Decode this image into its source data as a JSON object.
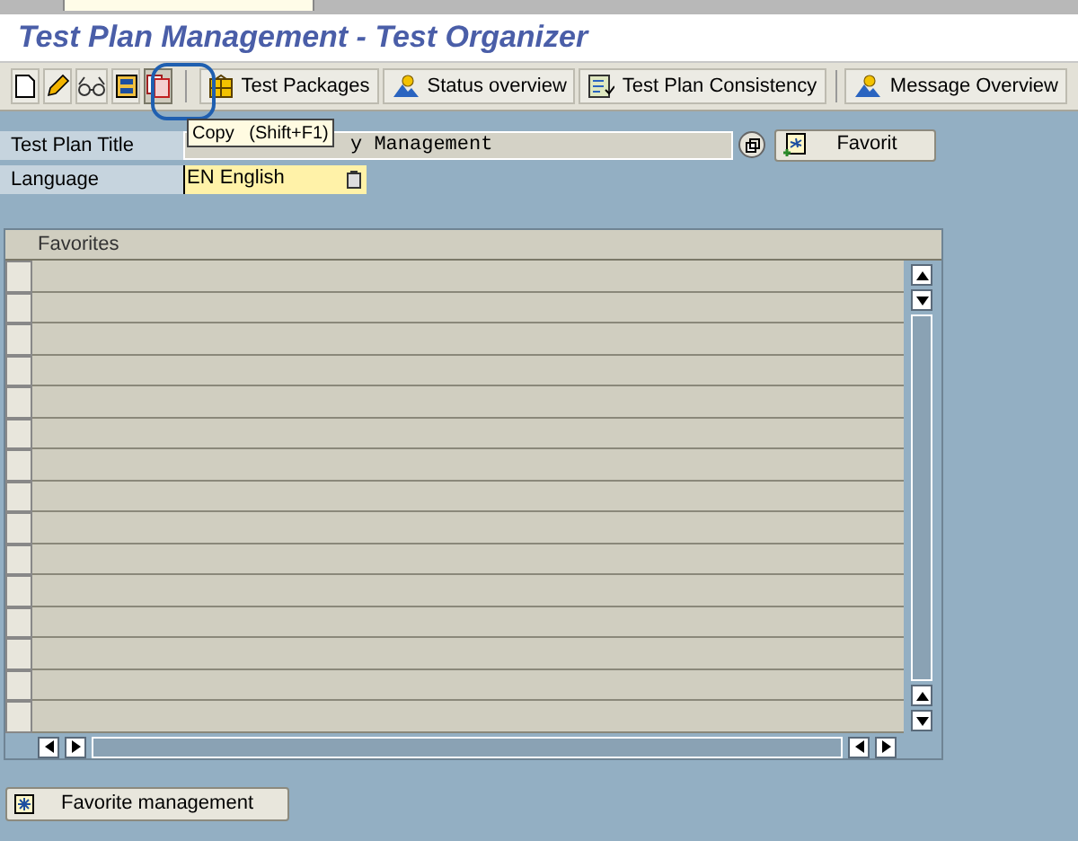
{
  "window": {
    "title": "Test Plan Management - Test Organizer"
  },
  "toolbar": {
    "icon_buttons": [
      {
        "kind": "new",
        "pressed": false
      },
      {
        "kind": "edit",
        "pressed": false
      },
      {
        "kind": "display",
        "pressed": false
      },
      {
        "kind": "structure",
        "pressed": false
      },
      {
        "kind": "copy",
        "pressed": true
      }
    ],
    "buttons": [
      {
        "kind": "packages",
        "label": "Test Packages",
        "separator_before": false
      },
      {
        "kind": "status",
        "label": "Status overview",
        "separator_before": false
      },
      {
        "kind": "consistency",
        "label": "Test Plan Consistency",
        "separator_before": false
      },
      {
        "kind": "status",
        "label": "Message Overview",
        "separator_before": true
      }
    ]
  },
  "tooltip": {
    "text": "Copy   (Shift+F1)"
  },
  "form": {
    "title_label": "Test Plan Title",
    "title_value": "y Management",
    "favorite_button": "Favorit",
    "language_label": "Language",
    "language_value": "EN English"
  },
  "table": {
    "column": "Favorites",
    "rows": [
      {
        "selected": false
      },
      {
        "selected": false
      },
      {
        "selected": false
      },
      {
        "selected": false
      },
      {
        "selected": false
      },
      {
        "selected": false
      },
      {
        "selected": false
      },
      {
        "selected": false
      },
      {
        "selected": false
      },
      {
        "selected": false
      },
      {
        "selected": false
      },
      {
        "selected": false
      },
      {
        "selected": false
      },
      {
        "selected": false
      },
      {
        "selected": false
      }
    ]
  },
  "footer_button": "Favorite management"
}
